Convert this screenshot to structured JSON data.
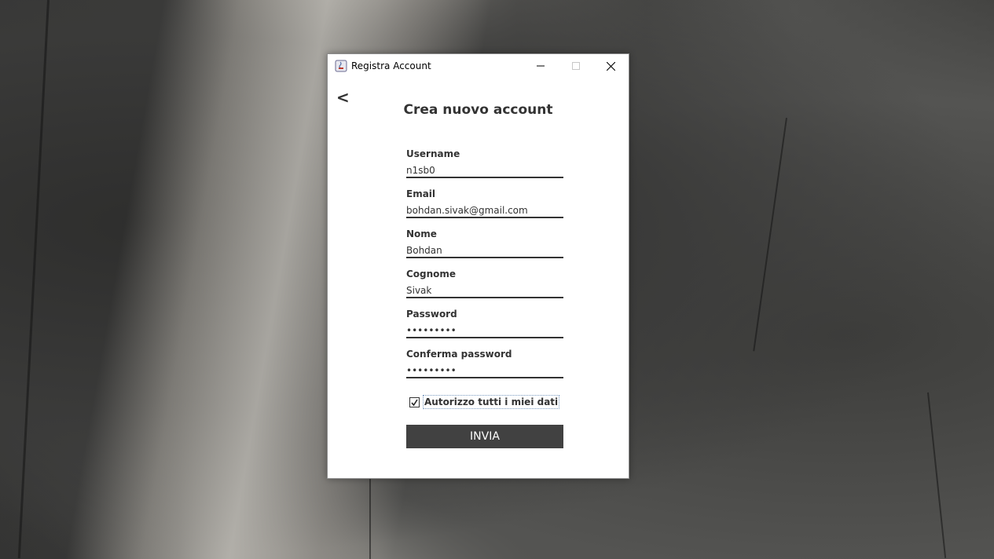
{
  "window": {
    "title": "Registra Account"
  },
  "form": {
    "back_label": "<",
    "heading": "Crea nuovo account",
    "fields": [
      {
        "label": "Username",
        "value": "n1sb0"
      },
      {
        "label": "Email",
        "value": "bohdan.sivak@gmail.com"
      },
      {
        "label": "Nome",
        "value": "Bohdan"
      },
      {
        "label": "Cognome",
        "value": "Sivak"
      },
      {
        "label": "Password",
        "value": "•••••••••"
      },
      {
        "label": "Conferma password",
        "value": "•••••••••"
      }
    ],
    "consent_label": "Autorizzo tutti i miei dati",
    "consent_checked": true,
    "submit_label": "INVIA"
  },
  "colors": {
    "accent": "#414141",
    "text": "#333333"
  }
}
